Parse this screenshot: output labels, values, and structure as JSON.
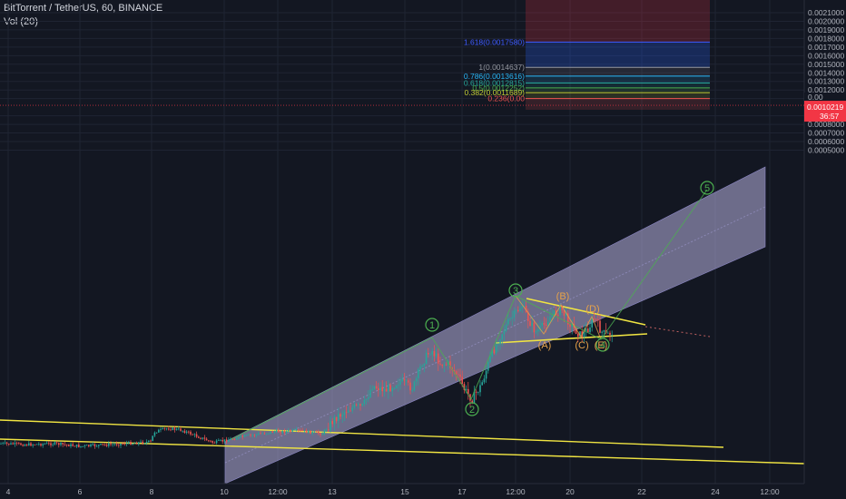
{
  "header": {
    "symbol_line": "BitTorrent / TetherUS, 60, BINANCE",
    "volume_label": "Vol (20)"
  },
  "colors": {
    "background": "#131722",
    "grid": "#1f2433",
    "candle_up": "#26a69a",
    "candle_down": "#ef5350",
    "channel_fill": "#b8b3e0",
    "trendline": "#f0e442",
    "wave_count": "#4caf50",
    "abcde_count": "#e6a24a",
    "price_tag": "#f23645",
    "projection_target": "#f23645",
    "projection_stop": "#2962ff"
  },
  "price_axis": {
    "ticks": [
      "0.0021000",
      "0.0020000",
      "0.0019000",
      "0.0018000",
      "0.0017000",
      "0.0016000",
      "0.0015000",
      "0.0014000",
      "0.0013000",
      "0.0012000",
      "0.0011000",
      "0.0009000",
      "0.0008000",
      "0.0007000",
      "0.0006000",
      "0.0005000"
    ],
    "current_price": "0.0010219",
    "countdown": "36:57",
    "partial_label": "0.00"
  },
  "time_axis": {
    "ticks": [
      "4",
      "6",
      "8",
      "10",
      "12:00",
      "13",
      "15",
      "17",
      "12:00",
      "20",
      "22",
      "24",
      "12:00"
    ]
  },
  "fib_levels": [
    {
      "ratio": "1.618",
      "label": "1.618(0.0017580)",
      "color": "#3d5afe"
    },
    {
      "ratio": "1",
      "label": "1(0.0014637)",
      "color": "#9598a1"
    },
    {
      "ratio": "0.786",
      "label": "0.786(0.0013616)",
      "color": "#29b6f6"
    },
    {
      "ratio": "0.618",
      "label": "0.618(0.0012815)",
      "color": "#26a69a"
    },
    {
      "ratio": "0.5",
      "label": "0.5(0.0012252)",
      "color": "#4caf50"
    },
    {
      "ratio": "0.382",
      "label": "0.382(0.0011689)",
      "color": "#c0ca33"
    },
    {
      "ratio": "0.236",
      "label": "0.236(0.00",
      "color": "#ef5350"
    }
  ],
  "wave_labels": {
    "impulse": [
      "1",
      "2",
      "3",
      "4",
      "5"
    ],
    "correction": [
      "(A)",
      "(B)",
      "(C)",
      "(D)",
      "(E)"
    ]
  },
  "chart_data": {
    "type": "candlestick",
    "title": "BitTorrent / TetherUS, 60, BINANCE",
    "y_range": [
      0.00048,
      0.00216
    ],
    "y_axis_position": "right",
    "grid": true,
    "x_ticks": [
      "4",
      "6",
      "8",
      "10",
      "12:00",
      "13",
      "15",
      "17",
      "12:00",
      "20",
      "22",
      "24",
      "12:00"
    ],
    "y_ticks": [
      0.0021,
      0.002,
      0.0019,
      0.0018,
      0.0017,
      0.0016,
      0.0015,
      0.0014,
      0.0013,
      0.0012,
      0.0011,
      0.0009,
      0.0008,
      0.0007,
      0.0006,
      0.0005
    ],
    "last_price": 0.0010219,
    "price_path": [
      {
        "x": "4",
        "y": 0.00062
      },
      {
        "x": "6",
        "y": 0.00061
      },
      {
        "x": "8",
        "y": 0.00068
      },
      {
        "x": "10",
        "y": 0.00066
      },
      {
        "x": "12:00",
        "y": 0.00068
      },
      {
        "x": "13",
        "y": 0.00067
      },
      {
        "x": "14",
        "y": 0.00085
      },
      {
        "x": "15",
        "y": 0.00083
      },
      {
        "x": "16",
        "y": 0.00097
      },
      {
        "x": "17",
        "y": 0.00078
      },
      {
        "x": "18",
        "y": 0.00108
      },
      {
        "x": "19",
        "y": 0.00101
      },
      {
        "x": "20",
        "y": 0.00098
      },
      {
        "x": "21",
        "y": 0.00102
      }
    ],
    "fibonacci_extension": [
      {
        "ratio": 1.618,
        "price": 0.001758
      },
      {
        "ratio": 1,
        "price": 0.0014637
      },
      {
        "ratio": 0.786,
        "price": 0.0013616
      },
      {
        "ratio": 0.618,
        "price": 0.0012815
      },
      {
        "ratio": 0.5,
        "price": 0.0012252
      },
      {
        "ratio": 0.382,
        "price": 0.0011689
      }
    ]
  }
}
